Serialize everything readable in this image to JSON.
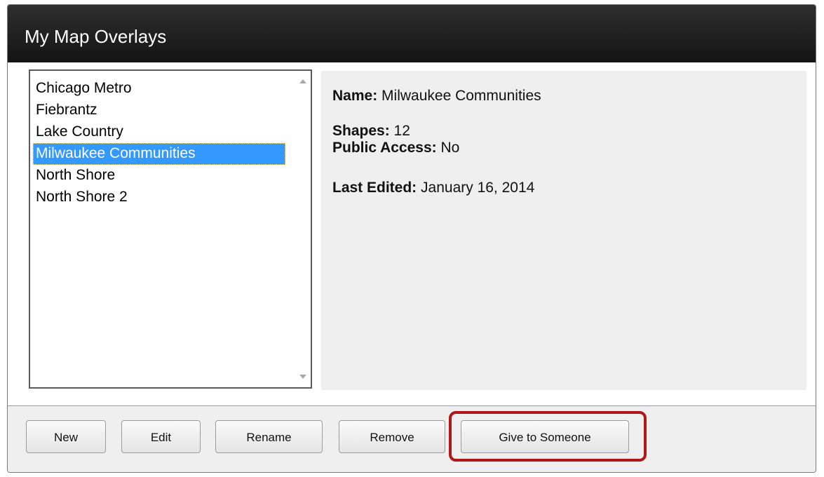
{
  "dialog": {
    "title": "My Map Overlays"
  },
  "overlays": {
    "items": [
      {
        "label": "Chicago Metro",
        "selected": false
      },
      {
        "label": "Fiebrantz",
        "selected": false
      },
      {
        "label": "Lake Country",
        "selected": false
      },
      {
        "label": "Milwaukee Communities",
        "selected": true
      },
      {
        "label": "North Shore",
        "selected": false
      },
      {
        "label": "North Shore 2",
        "selected": false
      }
    ]
  },
  "details": {
    "name_label": "Name:",
    "name_value": "Milwaukee Communities",
    "shapes_label": "Shapes:",
    "shapes_value": "12",
    "public_label": "Public Access:",
    "public_value": "No",
    "edited_label": "Last Edited:",
    "edited_value": "January 16, 2014"
  },
  "buttons": {
    "new": "New",
    "edit": "Edit",
    "rename": "Rename",
    "remove": "Remove",
    "give": "Give to Someone"
  },
  "colors": {
    "selection": "#3399ff",
    "highlight_outline": "#b01818",
    "title_bar": "#1f1f1f"
  }
}
